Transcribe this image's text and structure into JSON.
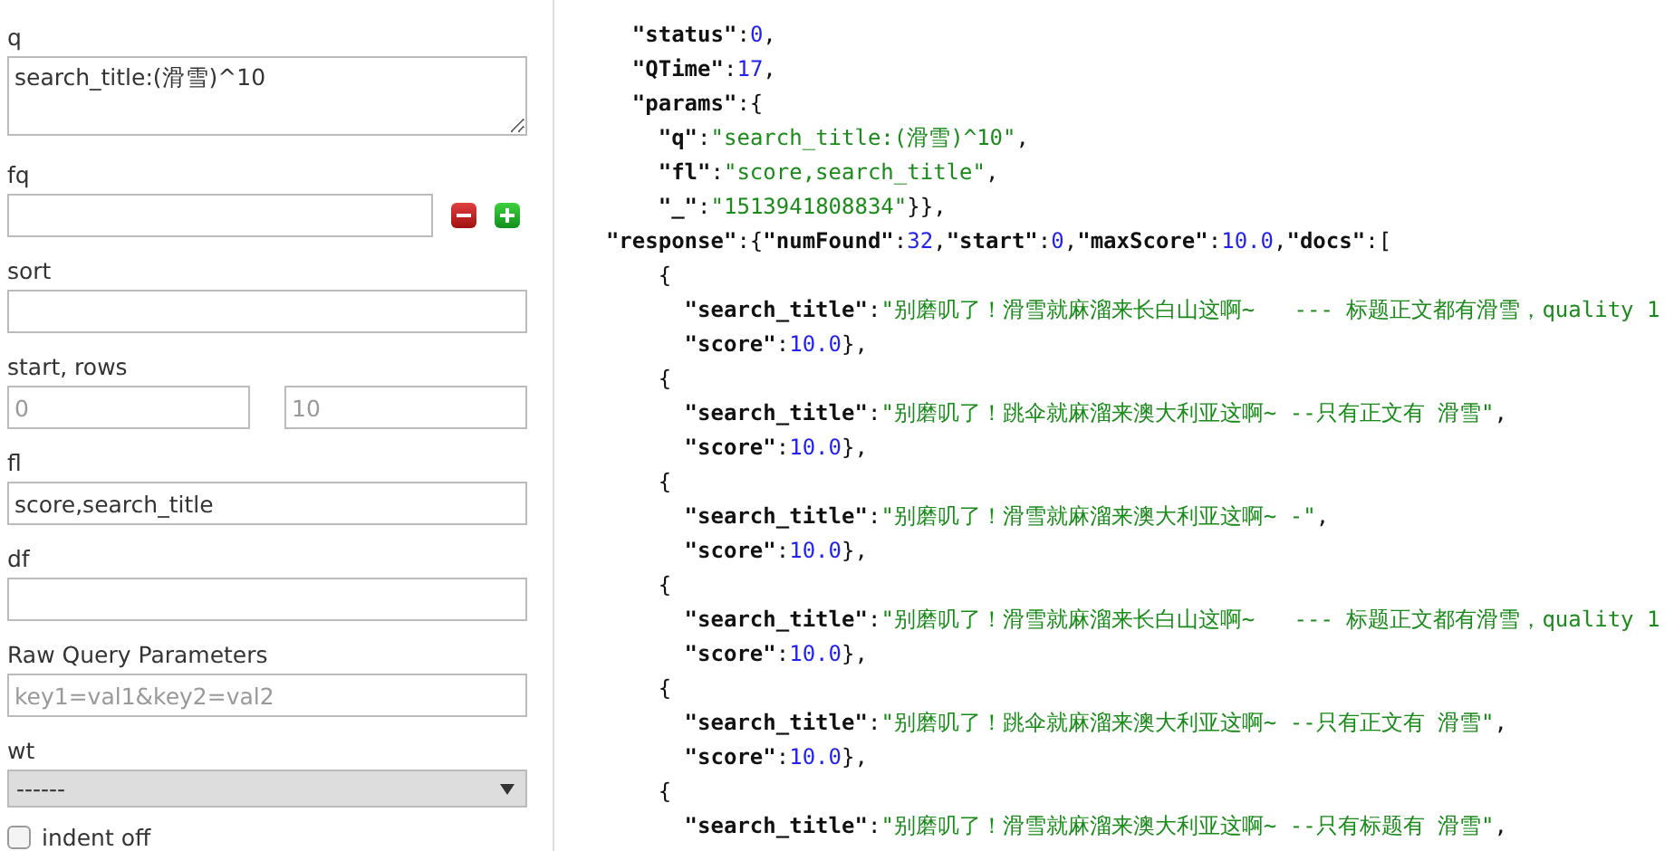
{
  "form": {
    "fields": [
      {
        "kind": "textarea",
        "label": "q",
        "value": "search_title:(滑雪)^10"
      },
      {
        "kind": "input_buttons",
        "label": "fq"
      },
      {
        "kind": "input",
        "label": "sort"
      },
      {
        "kind": "pair",
        "label": "start, rows",
        "placeholders": [
          "0",
          "10"
        ]
      },
      {
        "kind": "input",
        "label": "fl",
        "value": "score,search_title"
      },
      {
        "kind": "input",
        "label": "df"
      },
      {
        "kind": "input",
        "label": "Raw Query Parameters",
        "placeholder": "key1=val1&key2=val2"
      },
      {
        "kind": "select",
        "label": "wt",
        "value": "------"
      },
      {
        "kind": "checkbox",
        "label": "indent off",
        "checked": false
      }
    ]
  },
  "response_view": {
    "lines": [
      {
        "tokens": [
          {
            "kind": "k",
            "text": "    \"status\""
          },
          {
            "kind": "p",
            "text": ":"
          },
          {
            "kind": "n",
            "text": "0"
          },
          {
            "kind": "p",
            "text": ","
          }
        ]
      },
      {
        "tokens": [
          {
            "kind": "k",
            "text": "    \"QTime\""
          },
          {
            "kind": "p",
            "text": ":"
          },
          {
            "kind": "n",
            "text": "17"
          },
          {
            "kind": "p",
            "text": ","
          }
        ]
      },
      {
        "tokens": [
          {
            "kind": "k",
            "text": "    \"params\""
          },
          {
            "kind": "p",
            "text": ":{"
          }
        ]
      },
      {
        "tokens": [
          {
            "kind": "k",
            "text": "      \"q\""
          },
          {
            "kind": "p",
            "text": ":"
          },
          {
            "kind": "s",
            "text": "\"search_title:(滑雪)^10\""
          },
          {
            "kind": "p",
            "text": ","
          }
        ]
      },
      {
        "tokens": [
          {
            "kind": "k",
            "text": "      \"fl\""
          },
          {
            "kind": "p",
            "text": ":"
          },
          {
            "kind": "s",
            "text": "\"score,search_title\""
          },
          {
            "kind": "p",
            "text": ","
          }
        ]
      },
      {
        "tokens": [
          {
            "kind": "k",
            "text": "      \"_\""
          },
          {
            "kind": "p",
            "text": ":"
          },
          {
            "kind": "s",
            "text": "\"1513941808834\""
          },
          {
            "kind": "p",
            "text": "}},"
          }
        ]
      },
      {
        "tokens": [
          {
            "kind": "k",
            "text": "  \"response\""
          },
          {
            "kind": "p",
            "text": ":{"
          },
          {
            "kind": "k",
            "text": "\"numFound\""
          },
          {
            "kind": "p",
            "text": ":"
          },
          {
            "kind": "n",
            "text": "32"
          },
          {
            "kind": "p",
            "text": ","
          },
          {
            "kind": "k",
            "text": "\"start\""
          },
          {
            "kind": "p",
            "text": ":"
          },
          {
            "kind": "n",
            "text": "0"
          },
          {
            "kind": "p",
            "text": ","
          },
          {
            "kind": "k",
            "text": "\"maxScore\""
          },
          {
            "kind": "p",
            "text": ":"
          },
          {
            "kind": "n",
            "text": "10.0"
          },
          {
            "kind": "p",
            "text": ","
          },
          {
            "kind": "k",
            "text": "\"docs\""
          },
          {
            "kind": "p",
            "text": ":["
          }
        ]
      },
      {
        "tokens": [
          {
            "kind": "p",
            "text": "      {"
          }
        ]
      },
      {
        "tokens": [
          {
            "kind": "k",
            "text": "        \"search_title\""
          },
          {
            "kind": "p",
            "text": ":"
          },
          {
            "kind": "s",
            "text": "\"别磨叽了！滑雪就麻溜来长白山这啊~   --- 标题正文都有滑雪，quality 1"
          }
        ]
      },
      {
        "tokens": [
          {
            "kind": "k",
            "text": "        \"score\""
          },
          {
            "kind": "p",
            "text": ":"
          },
          {
            "kind": "n",
            "text": "10.0"
          },
          {
            "kind": "p",
            "text": "},"
          }
        ]
      },
      {
        "tokens": [
          {
            "kind": "p",
            "text": "      {"
          }
        ]
      },
      {
        "tokens": [
          {
            "kind": "k",
            "text": "        \"search_title\""
          },
          {
            "kind": "p",
            "text": ":"
          },
          {
            "kind": "s",
            "text": "\"别磨叽了！跳伞就麻溜来澳大利亚这啊~ --只有正文有 滑雪\""
          },
          {
            "kind": "p",
            "text": ","
          }
        ]
      },
      {
        "tokens": [
          {
            "kind": "k",
            "text": "        \"score\""
          },
          {
            "kind": "p",
            "text": ":"
          },
          {
            "kind": "n",
            "text": "10.0"
          },
          {
            "kind": "p",
            "text": "},"
          }
        ]
      },
      {
        "tokens": [
          {
            "kind": "p",
            "text": "      {"
          }
        ]
      },
      {
        "tokens": [
          {
            "kind": "k",
            "text": "        \"search_title\""
          },
          {
            "kind": "p",
            "text": ":"
          },
          {
            "kind": "s",
            "text": "\"别磨叽了！滑雪就麻溜来澳大利亚这啊~ -\""
          },
          {
            "kind": "p",
            "text": ","
          }
        ]
      },
      {
        "tokens": [
          {
            "kind": "k",
            "text": "        \"score\""
          },
          {
            "kind": "p",
            "text": ":"
          },
          {
            "kind": "n",
            "text": "10.0"
          },
          {
            "kind": "p",
            "text": "},"
          }
        ]
      },
      {
        "tokens": [
          {
            "kind": "p",
            "text": "      {"
          }
        ]
      },
      {
        "tokens": [
          {
            "kind": "k",
            "text": "        \"search_title\""
          },
          {
            "kind": "p",
            "text": ":"
          },
          {
            "kind": "s",
            "text": "\"别磨叽了！滑雪就麻溜来长白山这啊~   --- 标题正文都有滑雪，quality 1"
          }
        ]
      },
      {
        "tokens": [
          {
            "kind": "k",
            "text": "        \"score\""
          },
          {
            "kind": "p",
            "text": ":"
          },
          {
            "kind": "n",
            "text": "10.0"
          },
          {
            "kind": "p",
            "text": "},"
          }
        ]
      },
      {
        "tokens": [
          {
            "kind": "p",
            "text": "      {"
          }
        ]
      },
      {
        "tokens": [
          {
            "kind": "k",
            "text": "        \"search_title\""
          },
          {
            "kind": "p",
            "text": ":"
          },
          {
            "kind": "s",
            "text": "\"别磨叽了！跳伞就麻溜来澳大利亚这啊~ --只有正文有 滑雪\""
          },
          {
            "kind": "p",
            "text": ","
          }
        ]
      },
      {
        "tokens": [
          {
            "kind": "k",
            "text": "        \"score\""
          },
          {
            "kind": "p",
            "text": ":"
          },
          {
            "kind": "n",
            "text": "10.0"
          },
          {
            "kind": "p",
            "text": "},"
          }
        ]
      },
      {
        "tokens": [
          {
            "kind": "p",
            "text": "      {"
          }
        ]
      },
      {
        "tokens": [
          {
            "kind": "k",
            "text": "        \"search_title\""
          },
          {
            "kind": "p",
            "text": ":"
          },
          {
            "kind": "s",
            "text": "\"别磨叽了！滑雪就麻溜来澳大利亚这啊~ --只有标题有 滑雪\""
          },
          {
            "kind": "p",
            "text": ","
          }
        ]
      }
    ]
  }
}
